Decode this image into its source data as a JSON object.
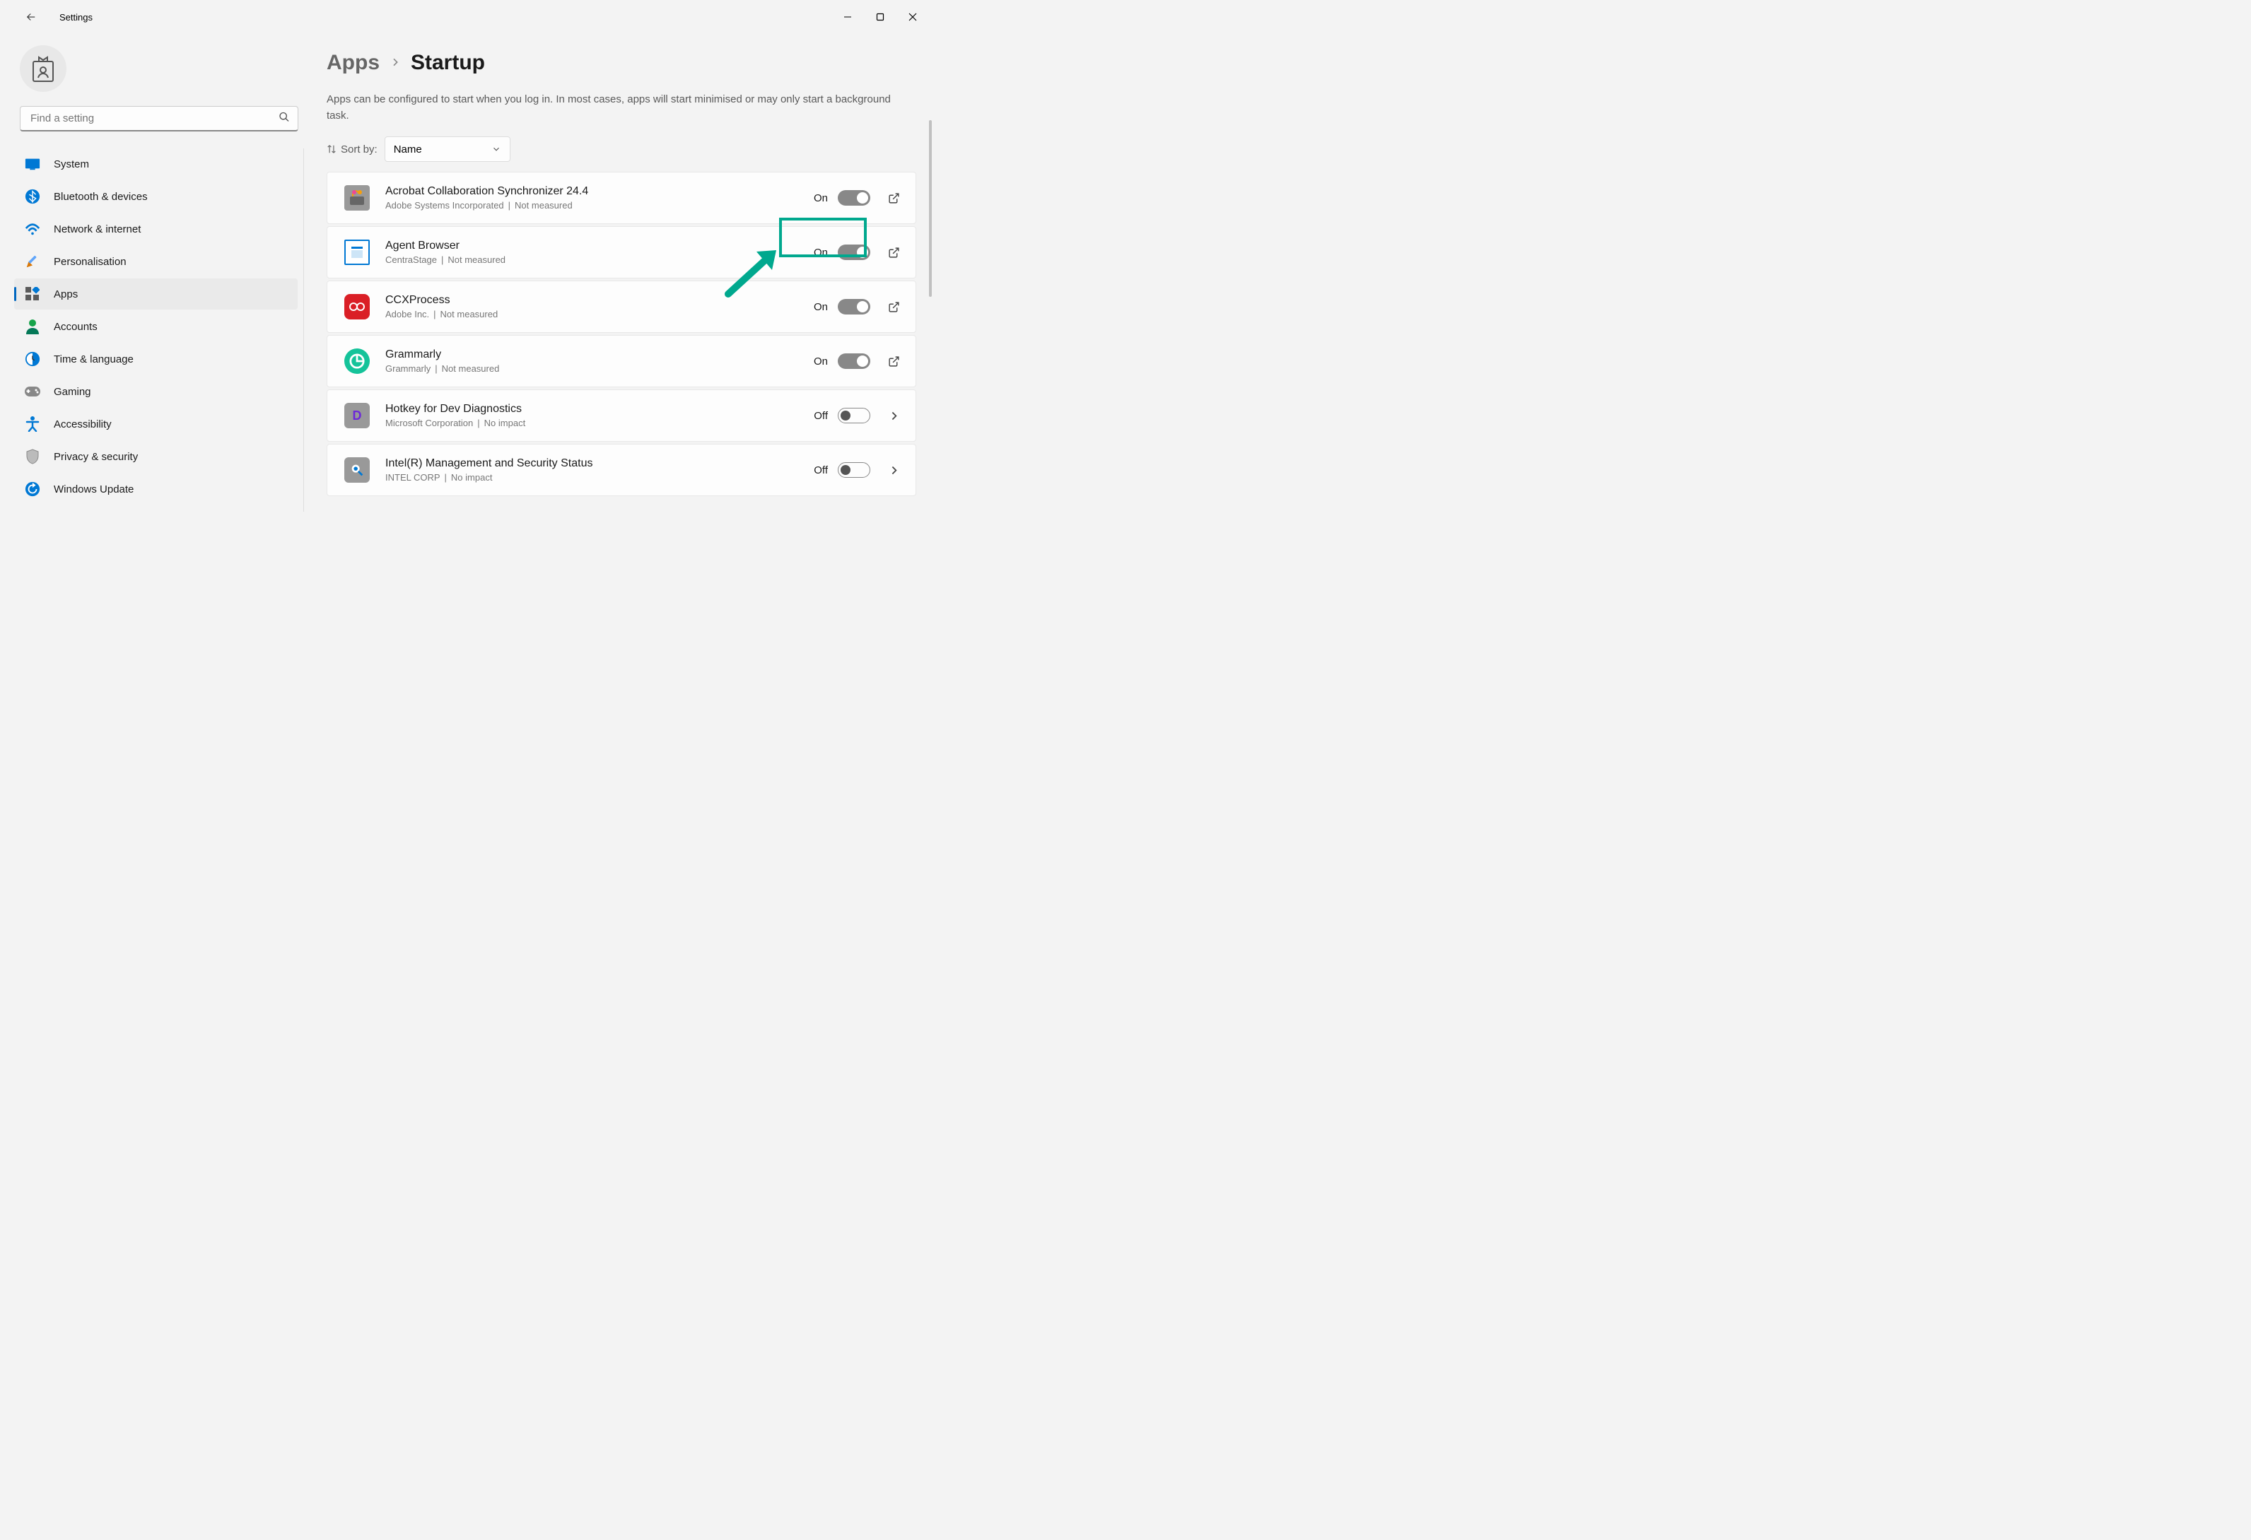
{
  "window": {
    "title": "Settings"
  },
  "search": {
    "placeholder": "Find a setting"
  },
  "sidebar": {
    "items": [
      {
        "label": "System",
        "icon": "system"
      },
      {
        "label": "Bluetooth & devices",
        "icon": "bluetooth"
      },
      {
        "label": "Network & internet",
        "icon": "network"
      },
      {
        "label": "Personalisation",
        "icon": "personalisation"
      },
      {
        "label": "Apps",
        "icon": "apps"
      },
      {
        "label": "Accounts",
        "icon": "accounts"
      },
      {
        "label": "Time & language",
        "icon": "time"
      },
      {
        "label": "Gaming",
        "icon": "gaming"
      },
      {
        "label": "Accessibility",
        "icon": "accessibility"
      },
      {
        "label": "Privacy & security",
        "icon": "privacy"
      },
      {
        "label": "Windows Update",
        "icon": "update"
      }
    ],
    "activeIndex": 4
  },
  "breadcrumb": {
    "parent": "Apps",
    "current": "Startup"
  },
  "page": {
    "description": "Apps can be configured to start when you log in. In most cases, apps will start minimised or may only start a background task.",
    "sortLabel": "Sort by:",
    "sortValue": "Name"
  },
  "apps": [
    {
      "name": "Acrobat Collaboration Synchronizer 24.4",
      "publisher": "Adobe Systems Incorporated",
      "impact": "Not measured",
      "state": "On",
      "action": "open"
    },
    {
      "name": "Agent Browser",
      "publisher": "CentraStage",
      "impact": "Not measured",
      "state": "On",
      "action": "open"
    },
    {
      "name": "CCXProcess",
      "publisher": "Adobe Inc.",
      "impact": "Not measured",
      "state": "On",
      "action": "open"
    },
    {
      "name": "Grammarly",
      "publisher": "Grammarly",
      "impact": "Not measured",
      "state": "On",
      "action": "open"
    },
    {
      "name": "Hotkey for Dev Diagnostics",
      "publisher": "Microsoft Corporation",
      "impact": "No impact",
      "state": "Off",
      "action": "chevron"
    },
    {
      "name": "Intel(R) Management and Security Status",
      "publisher": "INTEL CORP",
      "impact": "No impact",
      "state": "Off",
      "action": "chevron"
    }
  ]
}
